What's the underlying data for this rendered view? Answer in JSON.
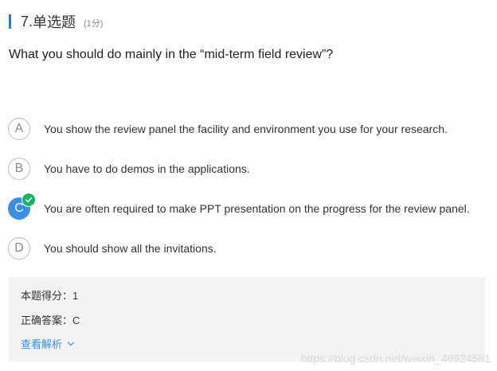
{
  "question": {
    "number": "7.",
    "type": "单选题",
    "score": "(1分)",
    "stem": "What you should do mainly in the “mid-term field review”?"
  },
  "options": [
    {
      "letter": "A",
      "text": "You show the review panel the facility and environment you use for your research.",
      "selected": false
    },
    {
      "letter": "B",
      "text": "You have to do demos in the applications.",
      "selected": false
    },
    {
      "letter": "C",
      "text": "You are often required to make PPT presentation on the progress for the review panel.",
      "selected": true
    },
    {
      "letter": "D",
      "text": "You should show all the invitations.",
      "selected": false
    }
  ],
  "result": {
    "score_label": "本题得分：",
    "score_value": "1",
    "answer_label": "正确答案：",
    "answer_value": "C",
    "analysis_link": "查看解析"
  },
  "watermark": "https://blog.csdn.net/weixin_48924581",
  "colors": {
    "accent": "#3a8ee6",
    "bar": "#2c7bd8",
    "correct_badge": "#1ab26b",
    "result_bg": "#f3f3f3"
  }
}
